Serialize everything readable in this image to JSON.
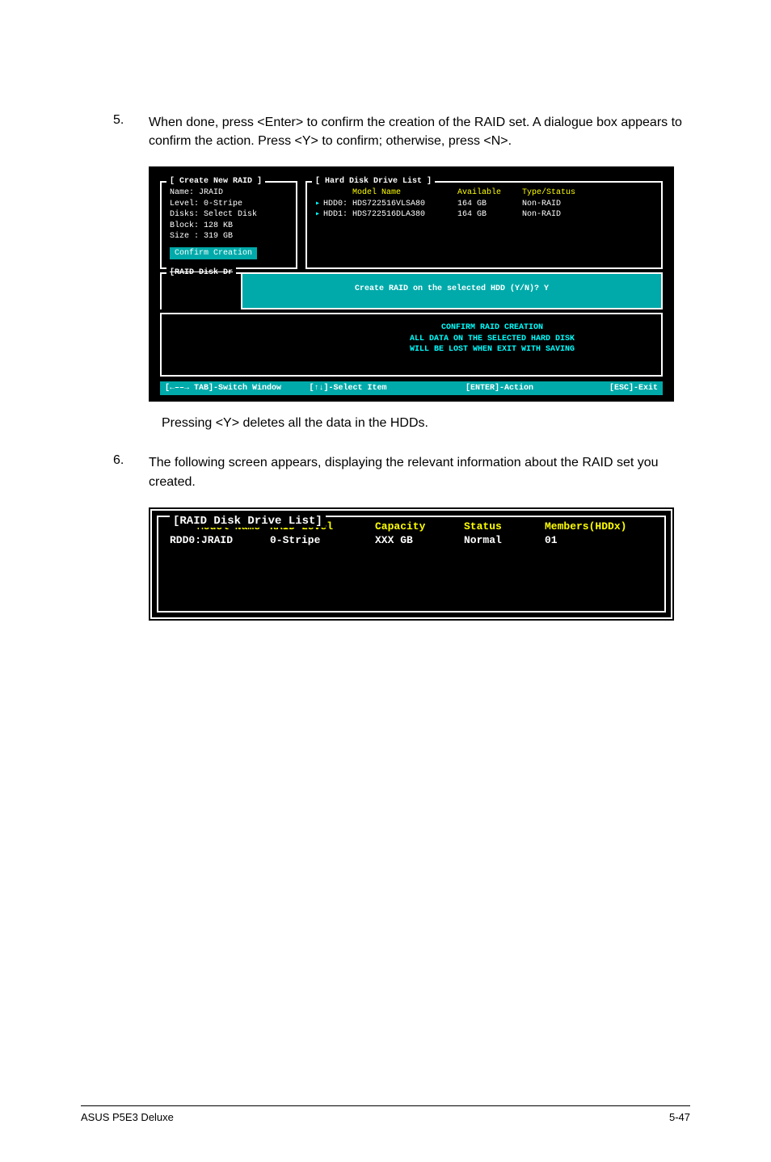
{
  "step5": {
    "num": "5.",
    "text": "When done, press <Enter> to confirm the creation of the RAID set. A dialogue box appears to confirm the action. Press <Y> to confirm; otherwise, press <N>."
  },
  "bios1": {
    "create_title": "Create New RAID",
    "name_line": "Name: JRAID",
    "level_line": "Level: 0-Stripe",
    "disks_line": "Disks: Select Disk",
    "block_line": "Block: 128 KB",
    "size_line": "Size : 319 GB",
    "confirm_creation": "Confirm Creation",
    "hdd_title": "Hard Disk Drive List",
    "hdd_head_model": "Model Name",
    "hdd_head_avail": "Available",
    "hdd_head_type": "Type/Status",
    "hdd_row0_a": "HDD0:",
    "hdd_row0_b": "HDS722516VLSA80",
    "hdd_row0_c": "164 GB",
    "hdd_row0_d": "Non-RAID",
    "hdd_row1_a": "HDD1:",
    "hdd_row1_b": "HDS722516DLA380",
    "hdd_row1_c": "164 GB",
    "hdd_row1_d": "Non-RAID",
    "raid_strip_title": "[RAID Disk Dr",
    "create_prompt": "Create RAID on the selected HDD (Y/N)? Y",
    "confirm_l1": "CONFIRM RAID CREATION",
    "confirm_l2": "ALL DATA ON THE SELECTED HARD DISK",
    "confirm_l3": "WILL BE LOST WHEN EXIT WITH SAVING",
    "bottom_seg1": "[←––→ TAB]-Switch Window",
    "bottom_seg2": "[↑↓]-Select Item",
    "bottom_seg3": "[ENTER]-Action",
    "bottom_seg4": "[ESC]-Exit"
  },
  "note": "Pressing <Y> deletes all the data in the HDDs.",
  "step6": {
    "num": "6.",
    "text": "The following screen appears, displaying the relevant information about the RAID set you created."
  },
  "bios2": {
    "title": "[RAID Disk Drive List]",
    "head": {
      "c1": "Model Name",
      "c2": "RAID Level",
      "c3": "Capacity",
      "c4": "Status",
      "c5": "Members(HDDx)"
    },
    "row": {
      "c1": "RDD0:JRAID",
      "c2": "0-Stripe",
      "c3": "XXX GB",
      "c4": "Normal",
      "c5": "01"
    }
  },
  "footer_left": "ASUS P5E3 Deluxe",
  "footer_right": "5-47"
}
